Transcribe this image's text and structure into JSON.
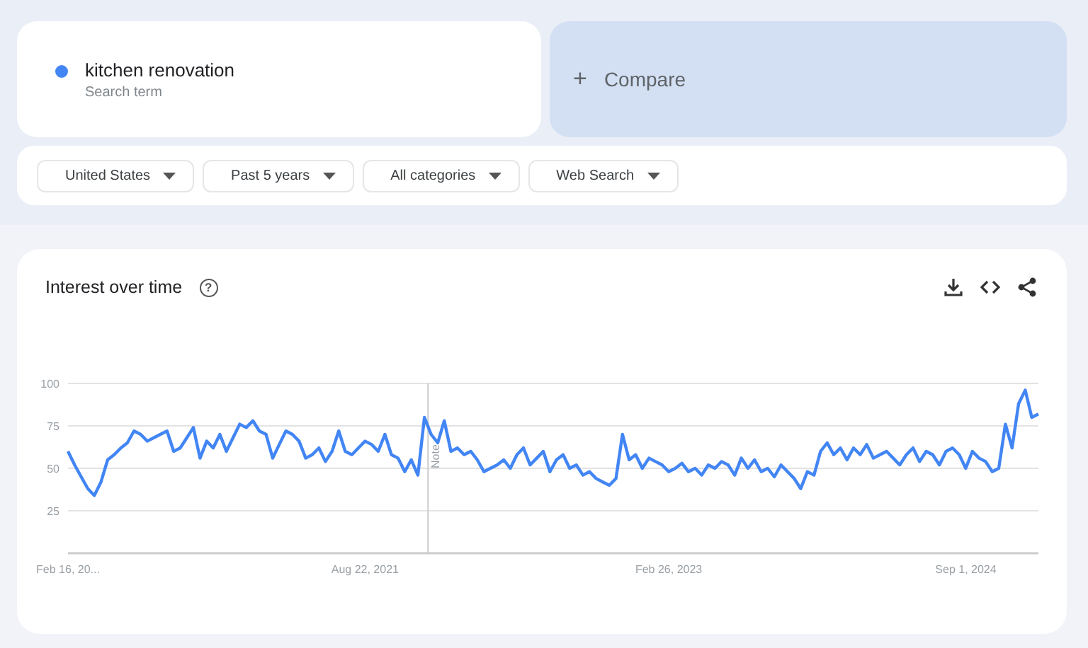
{
  "search_term": {
    "label": "kitchen renovation",
    "sublabel": "Search term",
    "color": "#4285f4"
  },
  "compare": {
    "icon": "+",
    "label": "Compare"
  },
  "filters": [
    {
      "label": "United States"
    },
    {
      "label": "Past 5 years"
    },
    {
      "label": "All categories"
    },
    {
      "label": "Web Search"
    }
  ],
  "interest_over_time": {
    "title": "Interest over time",
    "help_icon": "?",
    "note_label": "Note",
    "chart_data": {
      "type": "line",
      "grid": true,
      "ylim": [
        0,
        100
      ],
      "yticks": [
        25,
        50,
        75,
        100
      ],
      "categories": [
        "Feb 16, 20...",
        null,
        null,
        null,
        null,
        null,
        null,
        null,
        null,
        null,
        null,
        null,
        null,
        null,
        null,
        null,
        null,
        null,
        null,
        null,
        null,
        null,
        null,
        null,
        null,
        null,
        null,
        null,
        null,
        null,
        null,
        null,
        null,
        null,
        null,
        null,
        null,
        null,
        null,
        null,
        null,
        null,
        null,
        null,
        null,
        "Aug 22, 2021",
        null,
        null,
        null,
        null,
        null,
        null,
        null,
        null,
        null,
        null,
        null,
        null,
        null,
        null,
        null,
        null,
        null,
        null,
        null,
        null,
        null,
        null,
        null,
        null,
        null,
        null,
        null,
        null,
        null,
        null,
        null,
        null,
        null,
        null,
        null,
        null,
        null,
        null,
        null,
        null,
        null,
        null,
        null,
        null,
        null,
        "Feb 26, 2023",
        null,
        null,
        null,
        null,
        null,
        null,
        null,
        null,
        null,
        null,
        null,
        null,
        null,
        null,
        null,
        null,
        null,
        null,
        null,
        null,
        null,
        null,
        null,
        null,
        null,
        null,
        null,
        null,
        null,
        null,
        null,
        null,
        null,
        null,
        null,
        null,
        null,
        null,
        null,
        null,
        null,
        null,
        null,
        null,
        "Sep 1, 2024",
        null,
        null,
        null,
        null,
        null,
        null,
        null,
        null,
        null,
        null,
        null
      ],
      "series": [
        {
          "color": "#4285f4",
          "values": [
            60,
            52,
            45,
            38,
            34,
            42,
            55,
            58,
            62,
            65,
            72,
            70,
            66,
            68,
            70,
            72,
            60,
            62,
            68,
            74,
            56,
            66,
            62,
            70,
            60,
            68,
            76,
            74,
            78,
            72,
            70,
            56,
            64,
            72,
            70,
            66,
            56,
            58,
            62,
            54,
            60,
            72,
            60,
            58,
            62,
            66,
            64,
            60,
            70,
            58,
            56,
            48,
            55,
            46,
            80,
            70,
            65,
            78,
            60,
            62,
            58,
            60,
            55,
            48,
            50,
            52,
            55,
            50,
            58,
            62,
            52,
            56,
            60,
            48,
            55,
            58,
            50,
            52,
            46,
            48,
            44,
            42,
            40,
            44,
            70,
            55,
            58,
            50,
            56,
            54,
            52,
            48,
            50,
            53,
            48,
            50,
            46,
            52,
            50,
            54,
            52,
            46,
            56,
            50,
            55,
            48,
            50,
            45,
            52,
            48,
            44,
            38,
            48,
            46,
            60,
            65,
            58,
            62,
            55,
            62,
            58,
            64,
            56,
            58,
            60,
            56,
            52,
            58,
            62,
            54,
            60,
            58,
            52,
            60,
            62,
            58,
            50,
            60,
            56,
            54,
            48,
            50,
            76,
            62,
            88,
            96,
            80,
            82
          ]
        }
      ]
    }
  }
}
